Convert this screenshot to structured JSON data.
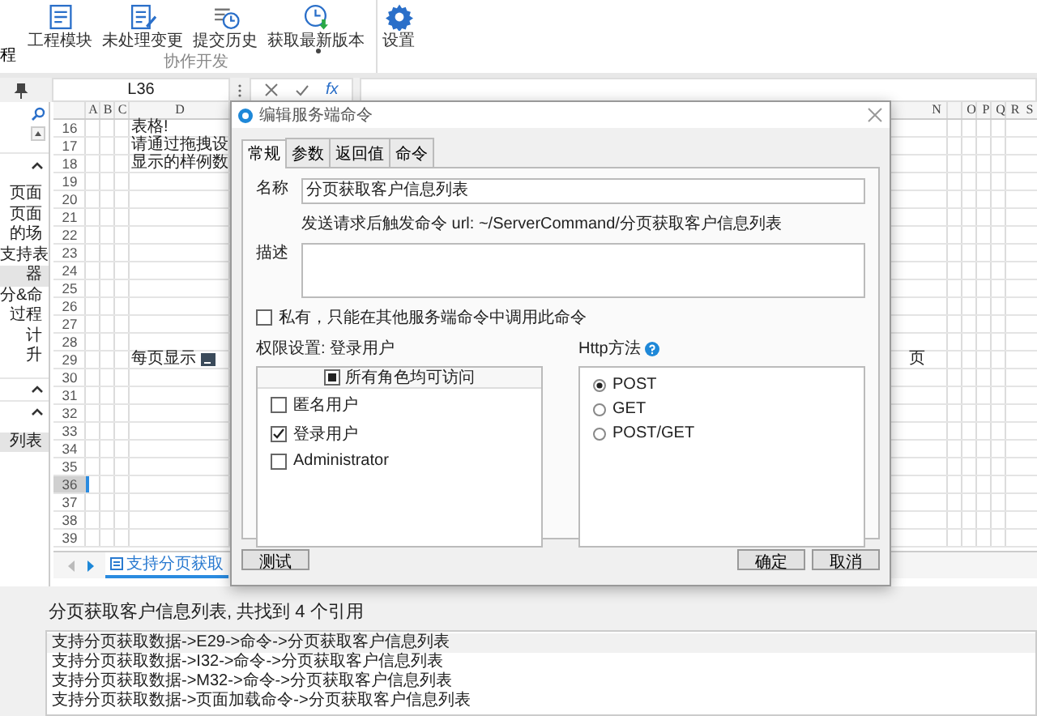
{
  "ribbon": {
    "leading_item": {
      "label": "程"
    },
    "group": {
      "label": "协作开发",
      "items": [
        {
          "kind": "module",
          "label": "工程模块"
        },
        {
          "kind": "changes",
          "label": "未处理变更"
        },
        {
          "kind": "history",
          "label": "提交历史"
        },
        {
          "kind": "update",
          "label": "获取最新版本",
          "dropdown": true
        }
      ]
    },
    "settings": {
      "label": "设置"
    }
  },
  "formula_bar": {
    "cell_name": "L36",
    "function_label": "fx"
  },
  "sidebar": {
    "sections": [
      {
        "expanded": true,
        "items": [
          {
            "label": "页面",
            "selected": false
          },
          {
            "label": "页面",
            "selected": false
          },
          {
            "label": "的场",
            "selected": false
          },
          {
            "label": "支持表",
            "selected": false
          },
          {
            "label": "器",
            "selected": true
          },
          {
            "label": "分&命",
            "selected": false
          },
          {
            "label": "过程",
            "selected": false
          },
          {
            "label": "计",
            "selected": false
          },
          {
            "label": "升",
            "selected": false
          }
        ]
      },
      {
        "expanded": true
      },
      {
        "expanded": true,
        "items": [
          {
            "label": "列表",
            "selected": true
          }
        ]
      }
    ]
  },
  "sheet": {
    "columns": [
      "A",
      "B",
      "C",
      "D",
      "N",
      "O",
      "P",
      "Q",
      "R",
      "S"
    ],
    "rows": [
      {
        "number": "16",
        "selected": false,
        "column_d": "表格!"
      },
      {
        "number": "17",
        "selected": false,
        "column_d": "请通过拖拽设"
      },
      {
        "number": "18",
        "selected": false,
        "column_d": "显示的样例数"
      },
      {
        "number": "19",
        "selected": false
      },
      {
        "number": "20",
        "selected": false
      },
      {
        "number": "21",
        "selected": false
      },
      {
        "number": "22",
        "selected": false
      },
      {
        "number": "23",
        "selected": false
      },
      {
        "number": "24",
        "selected": false
      },
      {
        "number": "25",
        "selected": false
      },
      {
        "number": "26",
        "selected": false
      },
      {
        "number": "27",
        "selected": false
      },
      {
        "number": "28",
        "selected": false
      },
      {
        "number": "29",
        "selected": false,
        "column_d": "每页显示",
        "has_input": true,
        "column_n": "页"
      },
      {
        "number": "30",
        "selected": false
      },
      {
        "number": "31",
        "selected": false
      },
      {
        "number": "32",
        "selected": false
      },
      {
        "number": "33",
        "selected": false
      },
      {
        "number": "34",
        "selected": false
      },
      {
        "number": "35",
        "selected": false
      },
      {
        "number": "36",
        "selected": true
      },
      {
        "number": "37",
        "selected": false
      },
      {
        "number": "38",
        "selected": false
      },
      {
        "number": "39",
        "selected": false
      }
    ],
    "tabs": [
      {
        "label": "支持分页获取",
        "selected": true
      }
    ]
  },
  "dialog": {
    "title": "编辑服务端命令",
    "tabs": [
      {
        "label": "常规",
        "selected": true
      },
      {
        "label": "参数",
        "selected": false
      },
      {
        "label": "返回值",
        "selected": false
      },
      {
        "label": "命令",
        "selected": false
      }
    ],
    "name_label": "名称",
    "name_value": "分页获取客户信息列表",
    "url_hint": "发送请求后触发命令 url: ~/ServerCommand/分页获取客户信息列表",
    "description_label": "描述",
    "private": {
      "label": "私有，只能在其他服务端命令中调用此命令",
      "checked": false
    },
    "permission": {
      "label": "权限设置: 登录用户",
      "header": {
        "label": "所有角色均可访问",
        "indeterminate": true
      },
      "roles": [
        {
          "label": "匿名用户",
          "checked": false
        },
        {
          "label": "登录用户",
          "checked": true
        },
        {
          "label": "Administrator",
          "checked": false
        }
      ]
    },
    "http": {
      "label": "Http方法",
      "methods": [
        {
          "label": "POST",
          "selected": true
        },
        {
          "label": "GET",
          "selected": false
        },
        {
          "label": "POST/GET",
          "selected": false
        }
      ]
    },
    "buttons": {
      "test": "测试",
      "ok": "确定",
      "cancel": "取消"
    }
  },
  "references": {
    "title": "分页获取客户信息列表, 共找到 4 个引用",
    "items": [
      {
        "label": "支持分页获取数据->E29->命令->分页获取客户信息列表",
        "selected": true
      },
      {
        "label": "支持分页获取数据->I32->命令->分页获取客户信息列表",
        "selected": false
      },
      {
        "label": "支持分页获取数据->M32->命令->分页获取客户信息列表",
        "selected": false
      },
      {
        "label": "支持分页获取数据->页面加载命令->分页获取客户信息列表",
        "selected": false
      }
    ]
  }
}
